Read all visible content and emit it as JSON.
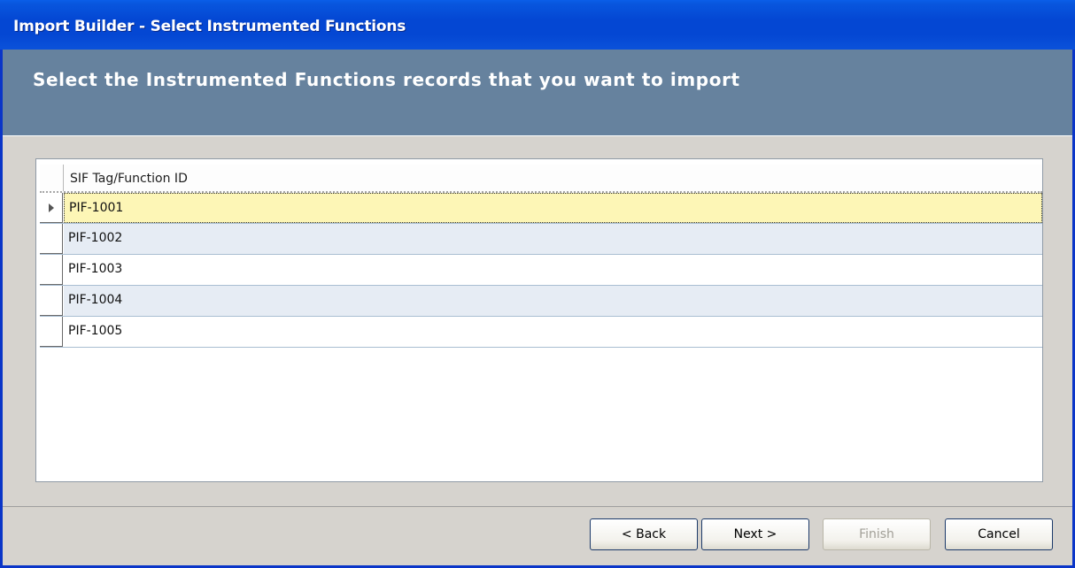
{
  "window": {
    "title": "Import Builder - Select Instrumented Functions"
  },
  "header": {
    "text": "Select the Instrumented Functions records that you want to import"
  },
  "grid": {
    "columns": [
      "SIF Tag/Function ID"
    ],
    "rows": [
      {
        "value": "PIF-1001"
      },
      {
        "value": "PIF-1002"
      },
      {
        "value": "PIF-1003"
      },
      {
        "value": "PIF-1004"
      },
      {
        "value": "PIF-1005"
      }
    ],
    "selected_row": 0
  },
  "buttons": {
    "back": "< Back",
    "next": "Next >",
    "finish": "Finish",
    "cancel": "Cancel"
  },
  "colors": {
    "title_bar": "#0447d3",
    "header_band": "#66829e",
    "selected_row": "#fdf6b6",
    "alt_row": "#e6ecf4"
  },
  "icons": {
    "row_indicator": "triangle-right-icon"
  }
}
